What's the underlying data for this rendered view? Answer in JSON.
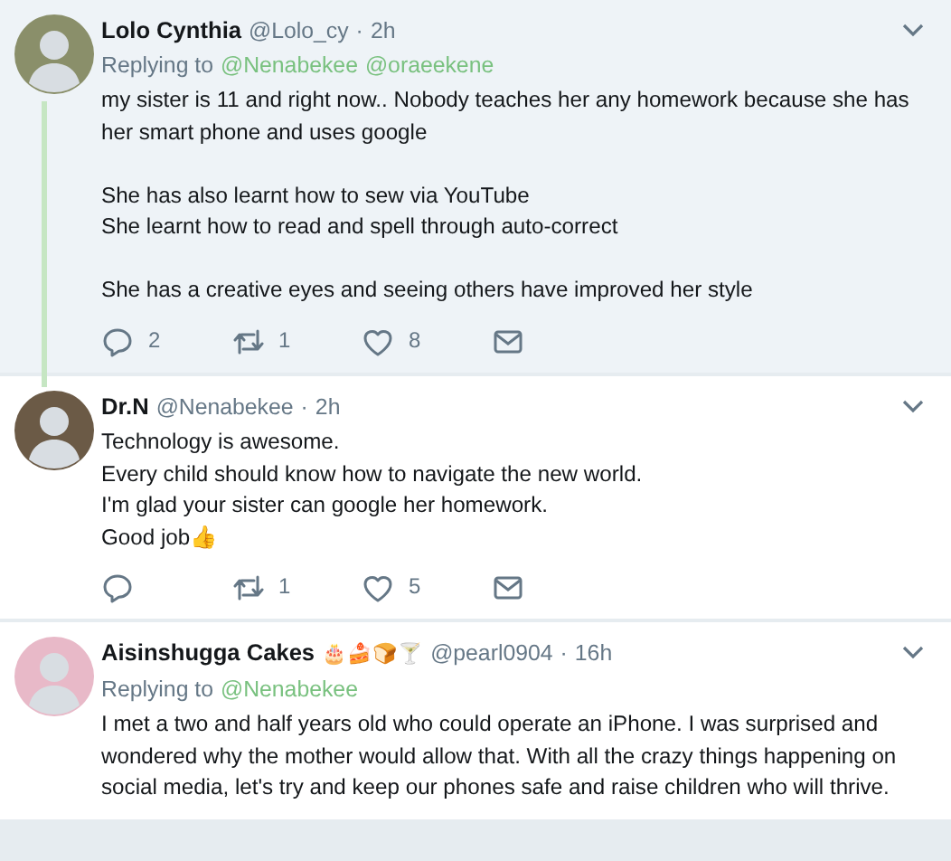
{
  "tweets": [
    {
      "name": "Lolo Cynthia",
      "handle": "@Lolo_cy",
      "dot": "·",
      "time": "2h",
      "highlighted": true,
      "thread_line": true,
      "replying_label": "Replying to",
      "replying_to": [
        "@Nenabekee",
        "@oraeekene"
      ],
      "text": "my sister is 11 and right now.. Nobody teaches her any homework because she has her smart phone and uses google\n\nShe has also learnt how to sew via YouTube\nShe learnt how to read and spell through auto-correct\n\nShe has a creative eyes and seeing others have improved her style",
      "actions": {
        "replies": "2",
        "retweets": "1",
        "likes": "8"
      }
    },
    {
      "name": "Dr.N",
      "handle": "@Nenabekee",
      "dot": "·",
      "time": "2h",
      "highlighted": false,
      "thread_line": false,
      "text": "Technology is awesome.\nEvery child should know how to navigate the new world.\nI'm glad your sister can google her homework.\nGood job👍",
      "actions": {
        "retweets": "1",
        "likes": "5"
      }
    },
    {
      "name": "Aisinshugga Cakes",
      "name_emoji": "🎂🍰🍞🍸",
      "handle": "@pearl0904",
      "dot": "·",
      "time": "16h",
      "highlighted": false,
      "thread_line": false,
      "replying_label": "Replying to",
      "replying_to": [
        "@Nenabekee"
      ],
      "text": "I met a two and half years old who could operate an iPhone. I was surprised and wondered why the mother would allow that. With all the crazy things happening on social media, let's try and keep our phones safe and raise children who will thrive."
    }
  ]
}
